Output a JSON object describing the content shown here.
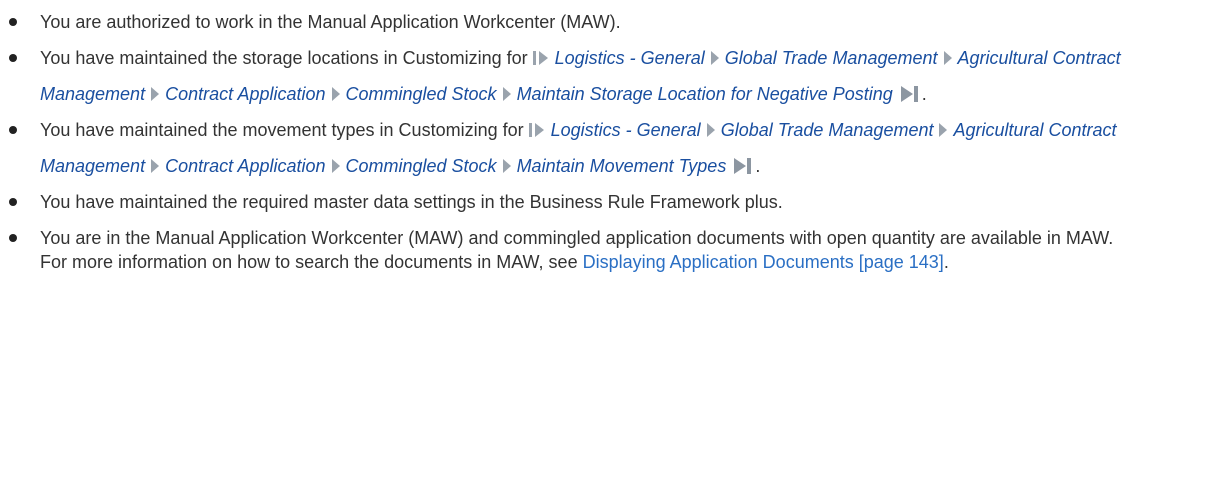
{
  "prerequisites": {
    "item1": "You are authorized to work in the Manual Application Workcenter (MAW).",
    "item2": {
      "lead": "You have maintained the storage locations in Customizing for ",
      "path": [
        "Logistics - General",
        "Global Trade Management",
        "Agricultural Contract Management",
        "Contract Application",
        "Commingled Stock",
        "Maintain Storage Location for Negative Posting"
      ],
      "end": "."
    },
    "item3": {
      "lead": "You have maintained the movement types in Customizing for ",
      "path": [
        "Logistics - General",
        "Global Trade Management",
        "Agricultural Contract Management",
        "Contract Application",
        "Commingled Stock",
        "Maintain Movement Types"
      ],
      "end": "."
    },
    "item4": "You have maintained the required master data settings in the Business Rule Framework plus.",
    "item5": {
      "line1": "You are in the Manual Application Workcenter (MAW) and commingled application documents with open quantity are available in MAW.",
      "line2_lead": "For more information on how to search the documents in MAW, see ",
      "link": "Displaying Application Documents [page 143]",
      "end": "."
    }
  },
  "icons": {
    "path_start": "path-start-icon",
    "path_separator": "path-separator-icon",
    "path_end": "path-end-icon",
    "bullet": "bullet-icon"
  },
  "colors": {
    "text": "#333333",
    "path_link": "#1a4fa0",
    "xref_link": "#2a6fc4",
    "path_marker": "#9aa3ad"
  }
}
